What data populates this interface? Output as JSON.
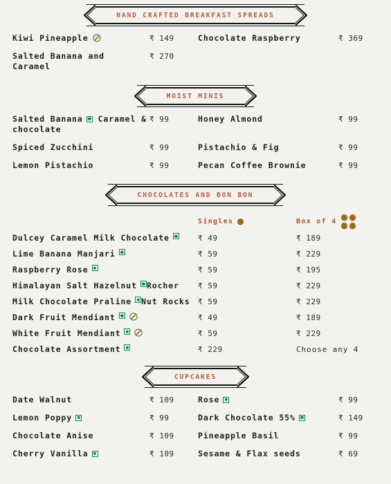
{
  "theme": {
    "background": "#f2f2ee",
    "text": "#1d1d1b",
    "accent": "#b2593a",
    "veg_green": "#0c8a45",
    "bonbon_brown": "#8a6320"
  },
  "currency": "₹",
  "icons": {
    "veg": "veg-mark-icon",
    "no_gluten": "no-gluten-icon",
    "bonbon": "bonbon-icon"
  },
  "sections": [
    {
      "title": "HAND CRAFTED BREAKFAST SPREADS",
      "layout": "two-column",
      "rows": [
        {
          "left": {
            "name": "Kiwi Pineapple",
            "veg": false,
            "no_gluten": true,
            "price": "₹ 149"
          },
          "right": {
            "name": "Chocolate Raspberry",
            "veg": false,
            "no_gluten": false,
            "price": "₹ 369"
          }
        },
        {
          "left": {
            "name": "Salted Banana and Caramel",
            "veg": false,
            "no_gluten": false,
            "price": "₹ 270"
          },
          "right": null
        }
      ]
    },
    {
      "title": "MOIST MINIS",
      "layout": "two-column",
      "rows": [
        {
          "left": {
            "name": "Salted Banana Caramel & chocolate",
            "veg": true,
            "veg_after": "Salted Banana",
            "no_gluten": false,
            "price": "₹ 99"
          },
          "right": {
            "name": "Honey Almond",
            "veg": false,
            "no_gluten": false,
            "price": "₹ 99"
          }
        },
        {
          "left": {
            "name": "Spiced Zucchini",
            "veg": false,
            "no_gluten": false,
            "price": "₹ 99"
          },
          "right": {
            "name": "Pistachio & Fig",
            "veg": false,
            "no_gluten": false,
            "price": "₹ 99"
          }
        },
        {
          "left": {
            "name": "Lemon Pistachio",
            "veg": false,
            "no_gluten": false,
            "price": "₹ 99"
          },
          "right": {
            "name": "Pecan Coffee Brownie",
            "veg": false,
            "no_gluten": false,
            "price": "₹ 99"
          }
        }
      ]
    },
    {
      "title": "CHOCOLATES AND BON BON",
      "layout": "price-table",
      "columns": [
        {
          "label": "Singles",
          "icon_count": 1
        },
        {
          "label": "Box of 4",
          "icon_count": 4
        }
      ],
      "rows": [
        {
          "name": "Dulcey Caramel Milk Chocolate",
          "veg": true,
          "no_gluten": false,
          "single": "₹ 49",
          "box": "₹ 189"
        },
        {
          "name": "Lime Banana Manjari",
          "veg": true,
          "no_gluten": false,
          "single": "₹ 59",
          "box": "₹ 229"
        },
        {
          "name": "Raspberry Rose",
          "veg": true,
          "no_gluten": false,
          "single": "₹ 59",
          "box": "₹ 195"
        },
        {
          "name": "Himalayan Salt Hazelnut Rocher",
          "veg": true,
          "no_gluten": false,
          "single": "₹ 59",
          "box": "₹ 229",
          "veg_after": "Himalayan Salt Hazelnut"
        },
        {
          "name": "Milk Chocolate Praline Nut Rocks",
          "veg": true,
          "no_gluten": false,
          "single": "₹ 59",
          "box": "₹ 229",
          "veg_after": "Milk Chocolate Praline"
        },
        {
          "name": "Dark Fruit Mendiant",
          "veg": true,
          "no_gluten": true,
          "single": "₹ 49",
          "box": "₹ 189"
        },
        {
          "name": "White Fruit Mendiant",
          "veg": true,
          "no_gluten": true,
          "single": "₹ 59",
          "box": "₹ 229"
        },
        {
          "name": "Chocolate Assortment",
          "veg": true,
          "no_gluten": false,
          "single": "₹ 229",
          "box": "Choose any 4"
        }
      ]
    },
    {
      "title": "CUPCAKES",
      "layout": "two-column",
      "rows": [
        {
          "left": {
            "name": "Date Walnut",
            "veg": false,
            "no_gluten": false,
            "price": "₹ 109"
          },
          "right": {
            "name": "Rose",
            "veg": true,
            "no_gluten": false,
            "price": "₹ 99"
          }
        },
        {
          "left": {
            "name": "Lemon Poppy",
            "veg": true,
            "no_gluten": false,
            "price": "₹ 99"
          },
          "right": {
            "name": "Dark Chocolate 55%",
            "veg": true,
            "no_gluten": false,
            "price": "₹ 149"
          }
        },
        {
          "left": {
            "name": "Chocolate Anise",
            "veg": false,
            "no_gluten": false,
            "price": "₹ 109"
          },
          "right": {
            "name": "Pineapple Basil",
            "veg": false,
            "no_gluten": false,
            "price": "₹ 99"
          }
        },
        {
          "left": {
            "name": "Cherry Vanilla",
            "veg": true,
            "no_gluten": false,
            "price": "₹ 109"
          },
          "right": {
            "name": "Sesame & Flax seeds",
            "veg": false,
            "no_gluten": false,
            "price": "₹ 69"
          }
        }
      ]
    }
  ]
}
